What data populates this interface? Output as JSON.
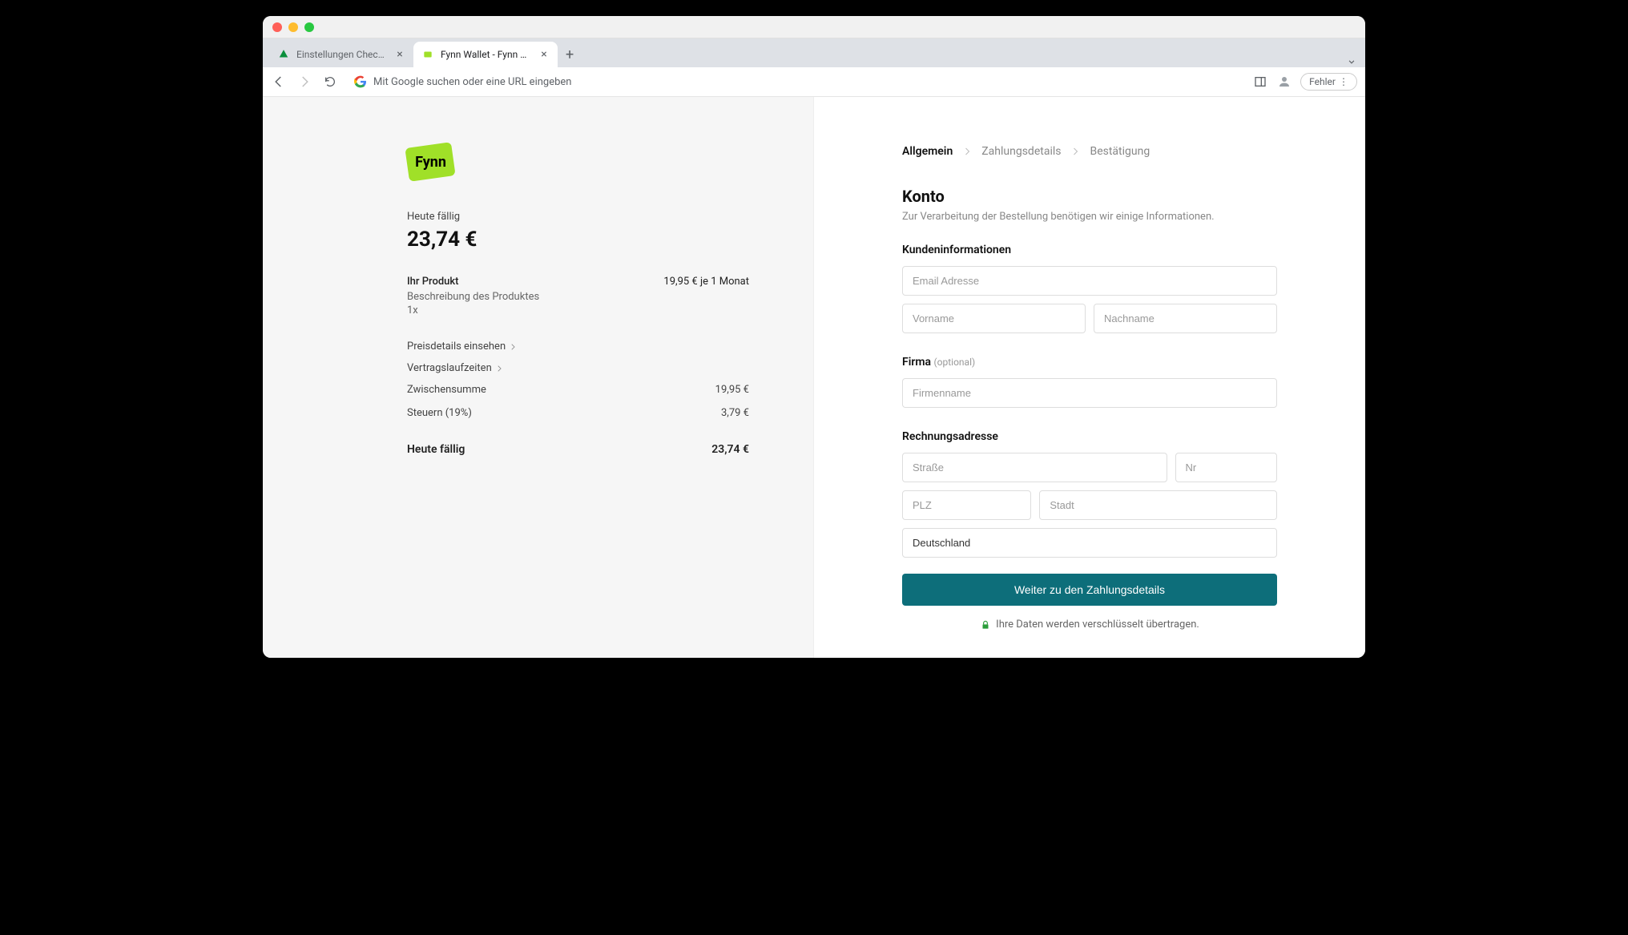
{
  "browser": {
    "tabs": [
      {
        "title": "Einstellungen Checkout - Fynn"
      },
      {
        "title": "Fynn Wallet - Fynn Wallet"
      }
    ],
    "omnibox_placeholder": "Mit Google suchen oder eine URL eingeben",
    "error_chip": "Fehler"
  },
  "brand": "Fynn",
  "summary": {
    "due_today_label": "Heute fällig",
    "due_today_amount": "23,74 €",
    "product_name": "Ihr Produkt",
    "product_price": "19,95 € je 1 Monat",
    "product_desc": "Beschreibung des Produktes",
    "product_qty": "1x",
    "price_details_link": "Preisdetails einsehen",
    "contract_link": "Vertragslaufzeiten",
    "subtotal_label": "Zwischensumme",
    "subtotal_value": "19,95 €",
    "tax_label": "Steuern (19%)",
    "tax_value": "3,79 €",
    "total_label": "Heute fällig",
    "total_value": "23,74 €"
  },
  "steps": {
    "s1": "Allgemein",
    "s2": "Zahlungsdetails",
    "s3": "Bestätigung"
  },
  "form": {
    "title": "Konto",
    "subtitle": "Zur Verarbeitung der Bestellung benötigen wir einige Informationen.",
    "customer_heading": "Kundeninformationen",
    "email_ph": "Email Adresse",
    "firstname_ph": "Vorname",
    "lastname_ph": "Nachname",
    "company_heading": "Firma",
    "company_optional": "(optional)",
    "company_ph": "Firmenname",
    "billing_heading": "Rechnungsadresse",
    "street_ph": "Straße",
    "nr_ph": "Nr",
    "zip_ph": "PLZ",
    "city_ph": "Stadt",
    "country_value": "Deutschland",
    "submit_label": "Weiter zu den Zahlungsdetails",
    "secure_note": "Ihre Daten werden verschlüsselt übertragen."
  }
}
